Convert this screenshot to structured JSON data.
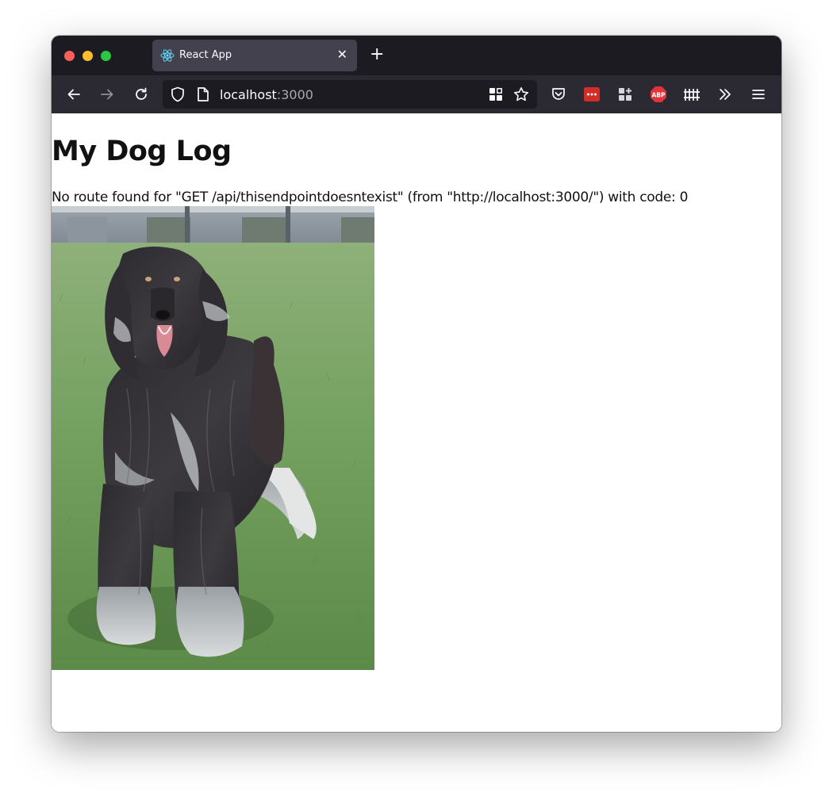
{
  "browser": {
    "tab": {
      "title": "React App",
      "close_icon": "close-icon",
      "favicon": "react-logo-icon"
    },
    "new_tab_label": "+",
    "url": {
      "host": "localhost",
      "port": ":3000"
    },
    "colors": {
      "tabstrip_bg": "#1c1b22",
      "toolbar_bg": "#2b2a33",
      "active_tab_bg": "#42414d",
      "react_blue": "#61dafb",
      "abp_red": "#e2333d",
      "lastpass_red": "#d32d27"
    },
    "toolbar_icons": [
      "back-icon",
      "forward-icon",
      "reload-icon",
      "shield-icon",
      "page-icon",
      "extensions-grid-icon",
      "bookmark-star-icon",
      "pocket-icon",
      "lastpass-icon",
      "widget-icon",
      "adblock-icon",
      "fence-icon",
      "overflow-chevron-icon",
      "menu-icon"
    ]
  },
  "page": {
    "title": "My Dog Log",
    "error_message": "No route found for \"GET /api/thisendpointdoesntexist\" (from \"http://localhost:3000/\") with code: 0",
    "image_subject": "afghan-hound-dog-photo"
  }
}
